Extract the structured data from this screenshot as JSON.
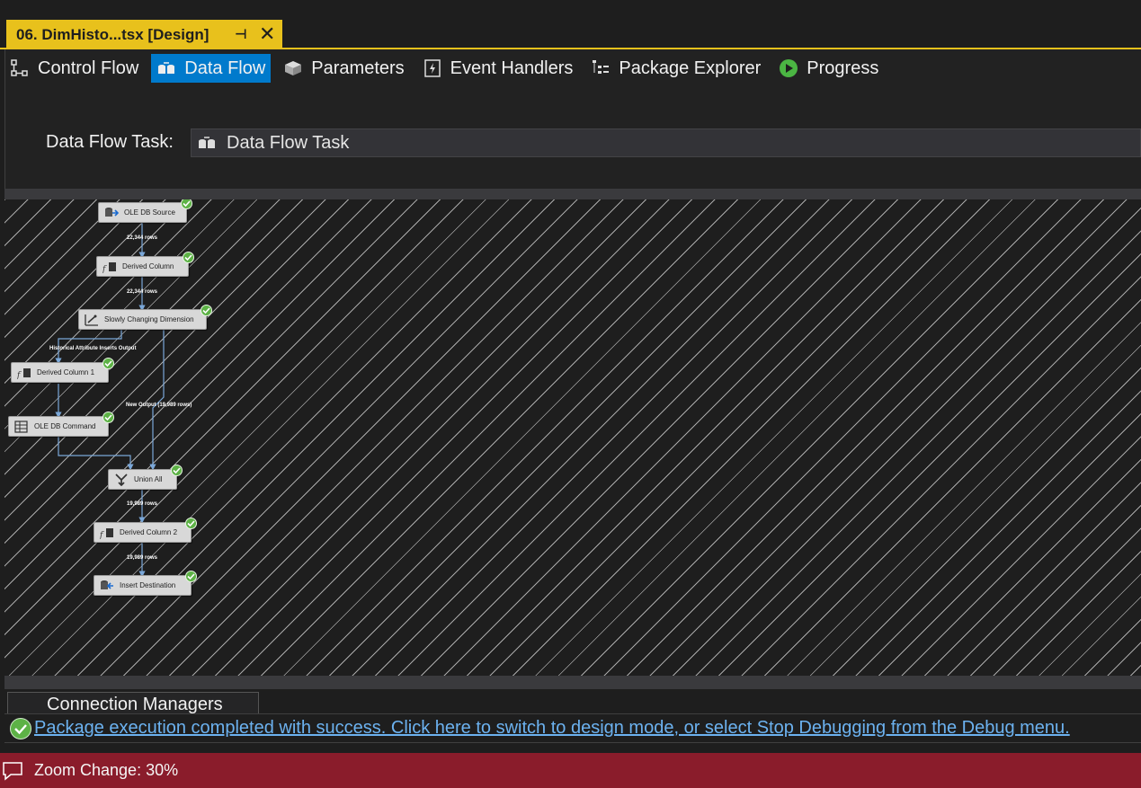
{
  "document_tab": {
    "title": "06. DimHisto...tsx [Design]",
    "pin_icon": "pin-icon",
    "close_icon": "close-icon"
  },
  "designer_tabs": [
    {
      "label": "Control Flow",
      "icon": "control-flow-icon",
      "active": false
    },
    {
      "label": "Data Flow",
      "icon": "data-flow-icon",
      "active": true
    },
    {
      "label": "Parameters",
      "icon": "parameters-icon",
      "active": false
    },
    {
      "label": "Event Handlers",
      "icon": "event-handlers-icon",
      "active": false
    },
    {
      "label": "Package Explorer",
      "icon": "package-explorer-icon",
      "active": false
    },
    {
      "label": "Progress",
      "icon": "progress-icon",
      "active": false
    }
  ],
  "task_selector": {
    "label": "Data Flow Task:",
    "value": "Data Flow Task"
  },
  "components": [
    {
      "name": "OLE DB Source",
      "icon": "ole-db-source-icon",
      "status": "success"
    },
    {
      "name": "Derived Column",
      "icon": "derived-column-icon",
      "status": "success"
    },
    {
      "name": "Slowly Changing Dimension",
      "icon": "scd-icon",
      "status": "success"
    },
    {
      "name": "Derived Column 1",
      "icon": "derived-column-icon",
      "status": "success"
    },
    {
      "name": "OLE DB Command",
      "icon": "ole-db-command-icon",
      "status": "success"
    },
    {
      "name": "Union All",
      "icon": "union-all-icon",
      "status": "success"
    },
    {
      "name": "Derived Column 2",
      "icon": "derived-column-icon",
      "status": "success"
    },
    {
      "name": "Insert Destination",
      "icon": "destination-icon",
      "status": "success"
    }
  ],
  "path_labels": {
    "source_to_derived": "22,344 rows",
    "derived_to_scd": "22,344 rows",
    "historical_output": "Historical Attribute Inserts Output",
    "new_output": "New Output (19,989 rows)",
    "union_to_derived2": "19,989 rows",
    "derived2_to_dest": "19,989 rows"
  },
  "connection_managers": {
    "label": "Connection Managers"
  },
  "status_message": "Package execution completed with success. Click here to switch to design mode, or select Stop Debugging from the Debug menu.",
  "statusbar": {
    "text": "Zoom Change: 30%"
  },
  "colors": {
    "accent": "#e8c11c",
    "active_tab": "#007acc",
    "statusbar": "#8a1c2b",
    "success": "#5db246",
    "link": "#6cb2f0"
  }
}
